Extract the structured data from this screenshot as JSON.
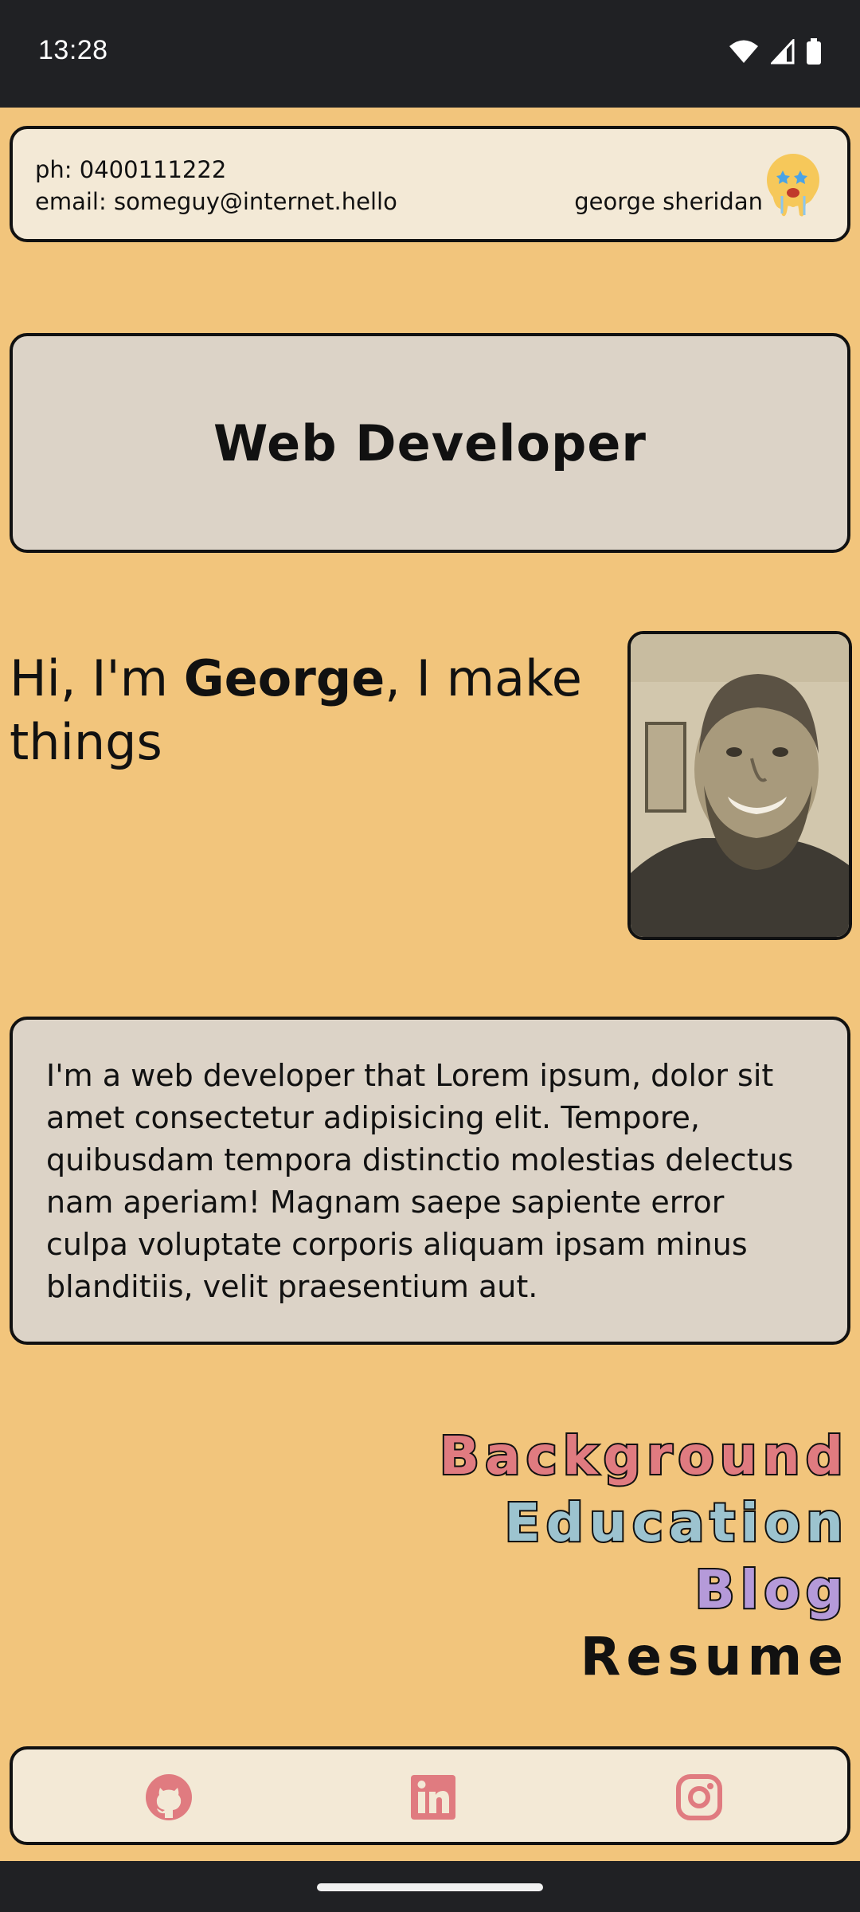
{
  "status_bar": {
    "time": "13:28"
  },
  "contact": {
    "phone": "ph: 0400111222",
    "email": "email: someguy@internet.hello",
    "name": "george sheridan"
  },
  "title": "Web Developer",
  "intro": {
    "prefix": "Hi, I'm ",
    "name": "George",
    "suffix": ", I make things"
  },
  "about": "I'm a web developer that Lorem ipsum, dolor sit amet consectetur adipisicing elit. Tempore, quibusdam tempora distinctio molestias delectus nam aperiam! Magnam saepe sapiente error culpa voluptate corporis aliquam ipsam minus blanditiis, velit praesentium aut.",
  "nav": {
    "background": "Background",
    "education": "Education",
    "blog": "Blog",
    "resume": "Resume"
  },
  "colors": {
    "page_bg": "#f2c57c",
    "card_light": "#f3e9d6",
    "card_grey": "#dcd3c7",
    "background_link": "#e07b80",
    "education_link": "#9cc3cf",
    "blog_link": "#b59ad9",
    "social_icons": "#e07b80"
  },
  "social": {
    "icons": [
      "github-icon",
      "linkedin-icon",
      "instagram-icon"
    ]
  }
}
